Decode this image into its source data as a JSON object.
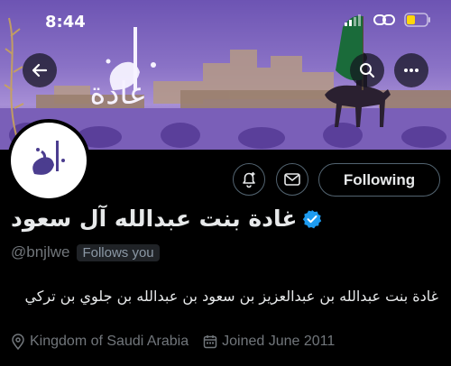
{
  "status_bar": {
    "time": "8:44"
  },
  "header": {
    "banner_calligraphy": "غادة"
  },
  "profile": {
    "display_name": "غادة بنت عبدالله آل سعود",
    "verified": true,
    "handle": "@bnjlwe",
    "follows_you_label": "Follows you",
    "bio": "غادة بنت عبدالله بن عبدالعزيز بن سعود بن عبدالله بن جلوي بن تركي",
    "location": "Kingdom of Saudi Arabia",
    "joined": "Joined June 2011"
  },
  "actions": {
    "follow_label": "Following"
  },
  "colors": {
    "verified_blue": "#1d9bf0",
    "muted_text": "#71767b",
    "border": "#536471"
  }
}
